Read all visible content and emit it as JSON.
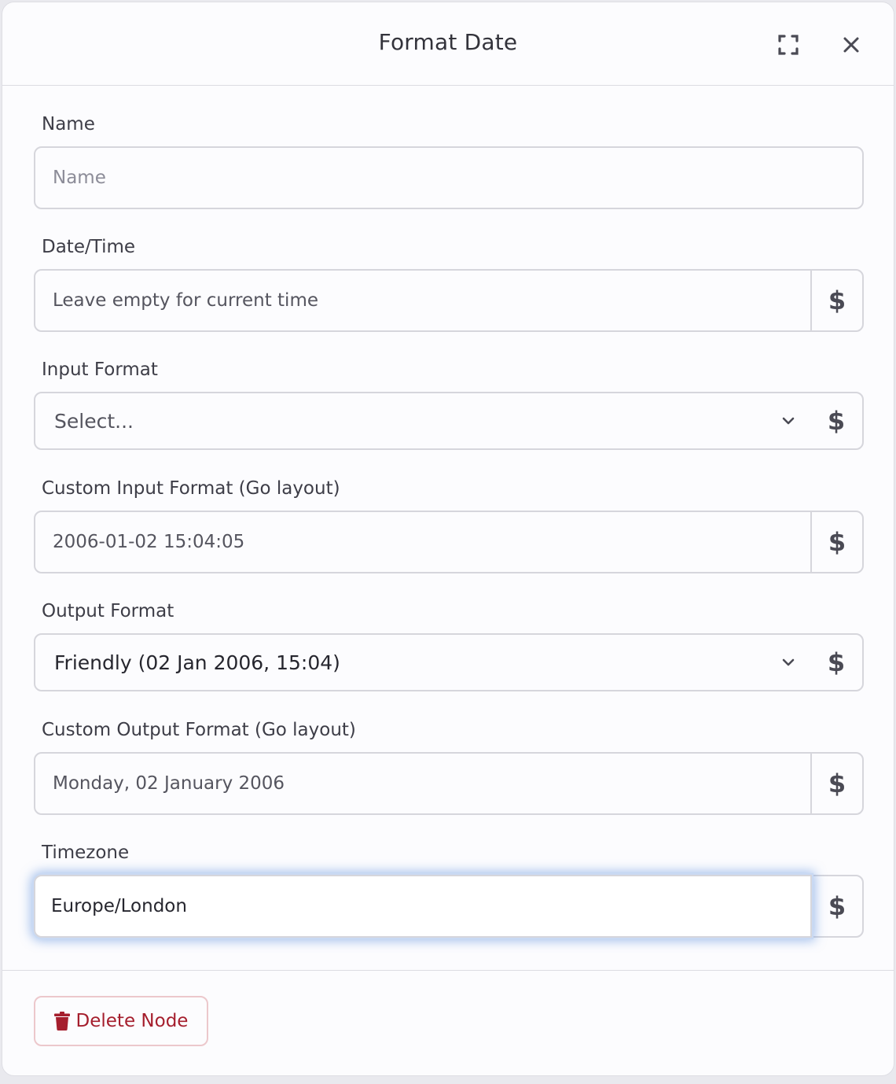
{
  "dialog": {
    "title": "Format Date",
    "icons": {
      "expand": "expand-icon",
      "close": "close-icon"
    }
  },
  "fields": {
    "name": {
      "label": "Name",
      "placeholder": "Name",
      "value": ""
    },
    "datetime": {
      "label": "Date/Time",
      "placeholder": "Leave empty for current time",
      "value": "",
      "dynamic_icon": "$"
    },
    "input_format": {
      "label": "Input Format",
      "selected": "Select...",
      "dynamic_icon": "$"
    },
    "custom_input_format": {
      "label": "Custom Input Format (Go layout)",
      "placeholder": "2006-01-02 15:04:05",
      "value": "",
      "dynamic_icon": "$"
    },
    "output_format": {
      "label": "Output Format",
      "selected": "Friendly (02 Jan 2006, 15:04)",
      "dynamic_icon": "$"
    },
    "custom_output_format": {
      "label": "Custom Output Format (Go layout)",
      "placeholder": "Monday, 02 January 2006",
      "value": "",
      "dynamic_icon": "$"
    },
    "timezone": {
      "label": "Timezone",
      "value": "Europe/London",
      "dynamic_icon": "$",
      "focused": true
    }
  },
  "footer": {
    "delete_label": "Delete Node",
    "delete_icon": "trash-icon",
    "delete_color": "#a51e2d"
  },
  "colors": {
    "focus_ring": "#588cdc",
    "border": "#d6d6dc"
  }
}
